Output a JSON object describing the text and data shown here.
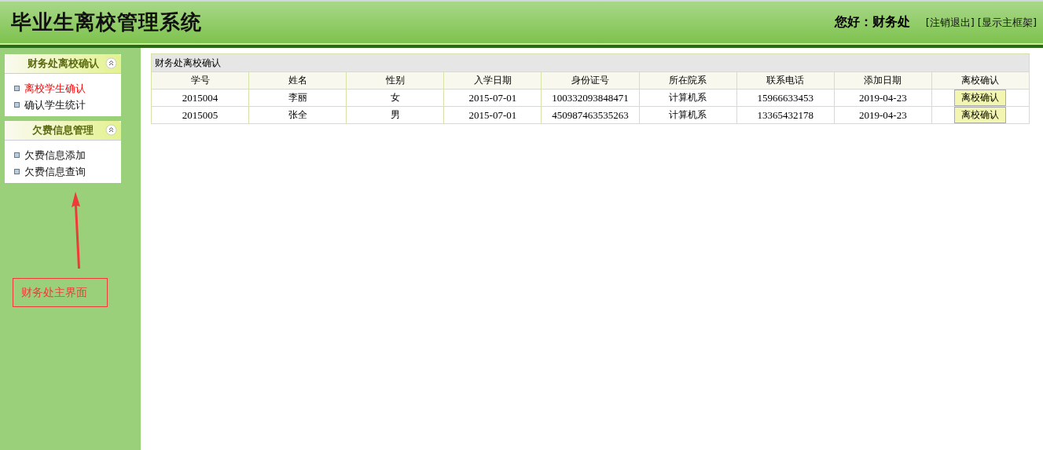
{
  "header": {
    "title": "毕业生离校管理系统",
    "greeting": "您好：财务处",
    "links": [
      "[注销退出]",
      "[显示主框架]"
    ]
  },
  "sidebar": {
    "sections": [
      {
        "title": "财务处离校确认",
        "expanded": true,
        "items": [
          {
            "label": "离校学生确认",
            "selected": true
          },
          {
            "label": "确认学生统计",
            "selected": false
          }
        ]
      },
      {
        "title": "欠费信息管理",
        "expanded": true,
        "items": [
          {
            "label": "欠费信息添加",
            "selected": false
          },
          {
            "label": "欠费信息查询",
            "selected": false
          }
        ]
      }
    ]
  },
  "annotation": {
    "text": "财务处主界面"
  },
  "table": {
    "title": "财务处离校确认",
    "columns": [
      "学号",
      "姓名",
      "性别",
      "入学日期",
      "身份证号",
      "所在院系",
      "联系电话",
      "添加日期",
      "离校确认"
    ],
    "rows": [
      {
        "cells": [
          "2015004",
          "李丽",
          "女",
          "2015-07-01",
          "100332093848471",
          "计算机系",
          "15966633453",
          "2019-04-23"
        ],
        "action": "离校确认"
      },
      {
        "cells": [
          "2015005",
          "张全",
          "男",
          "2015-07-01",
          "450987463535263",
          "计算机系",
          "13365432178",
          "2019-04-23"
        ],
        "action": "离校确认"
      }
    ]
  }
}
